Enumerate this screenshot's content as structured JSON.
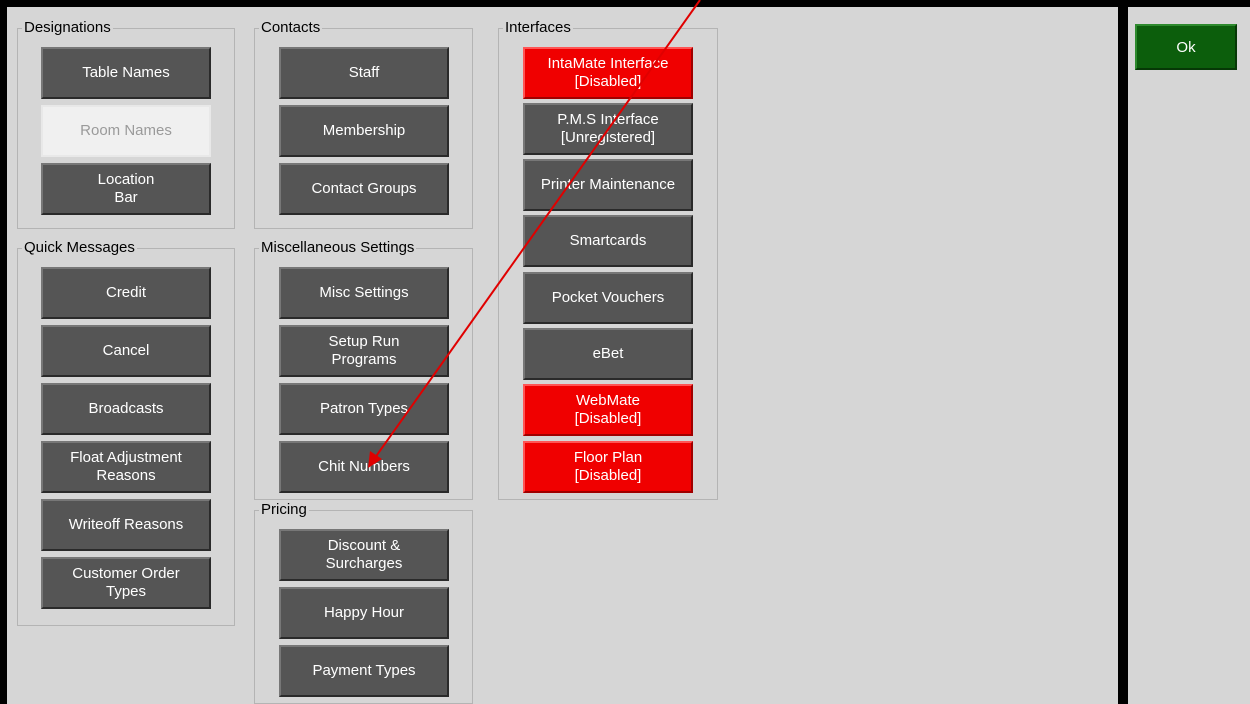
{
  "groups": {
    "designations": {
      "title": "Designations",
      "buttons": [
        "Table Names",
        "Room Names",
        "Location\nBar"
      ]
    },
    "quick_messages": {
      "title": "Quick Messages",
      "buttons": [
        "Credit",
        "Cancel",
        "Broadcasts",
        "Float Adjustment\nReasons",
        "Writeoff Reasons",
        "Customer Order\nTypes"
      ]
    },
    "contacts": {
      "title": "Contacts",
      "buttons": [
        "Staff",
        "Membership",
        "Contact Groups"
      ]
    },
    "misc": {
      "title": "Miscellaneous Settings",
      "buttons": [
        "Misc Settings",
        "Setup Run\nPrograms",
        "Patron Types",
        "Chit Numbers"
      ]
    },
    "pricing": {
      "title": "Pricing",
      "buttons": [
        "Discount &\nSurcharges",
        "Happy Hour",
        "Payment Types"
      ]
    },
    "interfaces": {
      "title": "Interfaces",
      "buttons": [
        "IntaMate Interface\n[Disabled]",
        "P.M.S Interface\n[Unregistered]",
        "Printer Maintenance",
        "Smartcards",
        "Pocket Vouchers",
        "eBet",
        "WebMate\n[Disabled]",
        "Floor Plan\n[Disabled]"
      ]
    }
  },
  "ok_label": "Ok",
  "colors": {
    "panel": "#d6d6d6",
    "button": "#555555",
    "button_disabled_state": "#f0f0f0",
    "button_red": "#f00000",
    "ok_green": "#0c5e0c",
    "annotation_arrow": "#e00000"
  }
}
